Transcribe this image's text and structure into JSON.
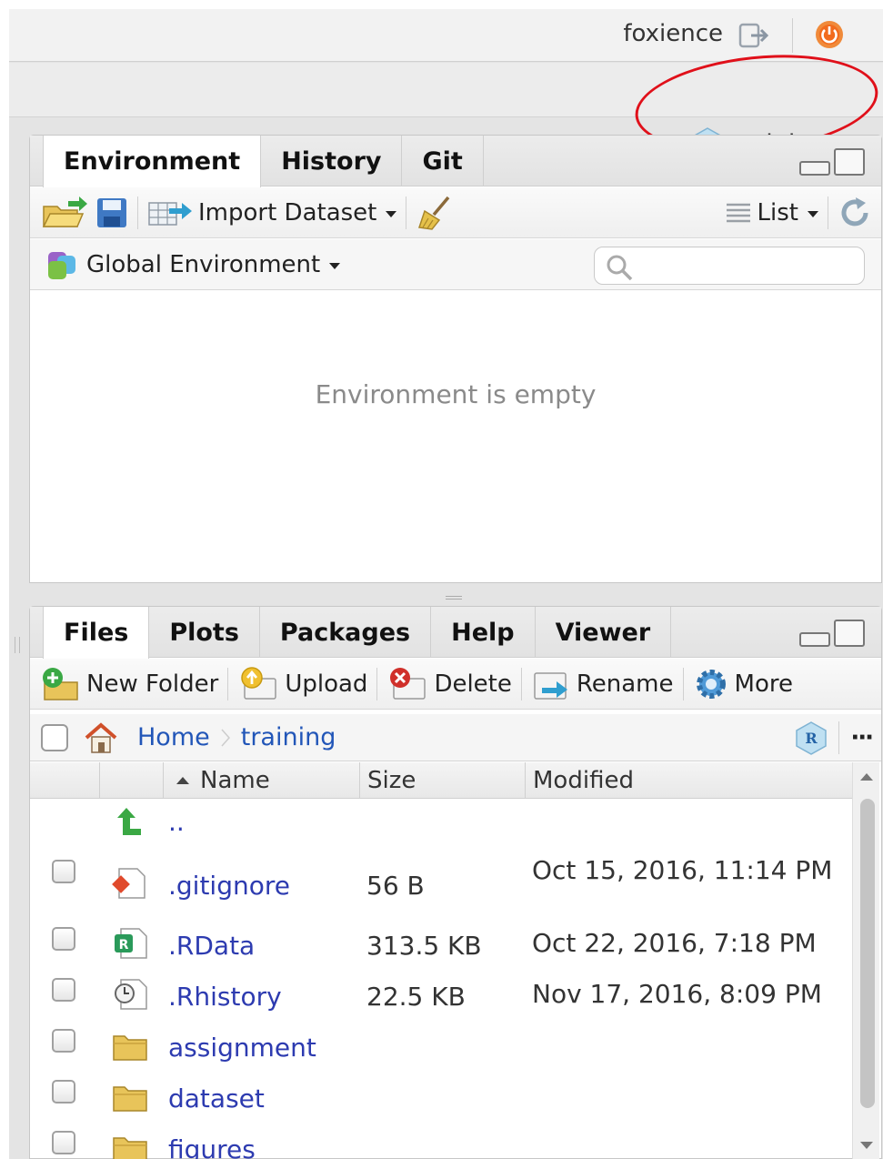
{
  "header": {
    "username": "foxience",
    "project_name": "training"
  },
  "env_pane": {
    "tabs": [
      "Environment",
      "History",
      "Git"
    ],
    "toolbar": {
      "import_label": "Import Dataset",
      "view_label": "List"
    },
    "scope_label": "Global Environment",
    "search_placeholder": "",
    "empty_message": "Environment is empty"
  },
  "files_pane": {
    "tabs": [
      "Files",
      "Plots",
      "Packages",
      "Help",
      "Viewer"
    ],
    "toolbar": {
      "new_folder": "New Folder",
      "upload": "Upload",
      "delete": "Delete",
      "rename": "Rename",
      "more": "More"
    },
    "breadcrumb": [
      "Home",
      "training"
    ],
    "more_dots": "···",
    "columns": {
      "name": "Name",
      "size": "Size",
      "modified": "Modified"
    },
    "rows": [
      {
        "name": "..",
        "size": "",
        "modified": "",
        "type": "parent"
      },
      {
        "name": ".gitignore",
        "size": "56 B",
        "modified": "Oct 15, 2016, 11:14 PM",
        "type": "text"
      },
      {
        "name": ".RData",
        "size": "313.5 KB",
        "modified": "Oct 22, 2016, 7:18 PM",
        "type": "rdata"
      },
      {
        "name": ".Rhistory",
        "size": "22.5 KB",
        "modified": "Nov 17, 2016, 8:09 PM",
        "type": "history"
      },
      {
        "name": "assignment",
        "size": "",
        "modified": "",
        "type": "folder"
      },
      {
        "name": "dataset",
        "size": "",
        "modified": "",
        "type": "folder"
      },
      {
        "name": "figures",
        "size": "",
        "modified": "",
        "type": "folder"
      }
    ]
  },
  "colors": {
    "annotation": "#e0101a",
    "link": "#2d3bb0",
    "crumb": "#2256b8"
  }
}
